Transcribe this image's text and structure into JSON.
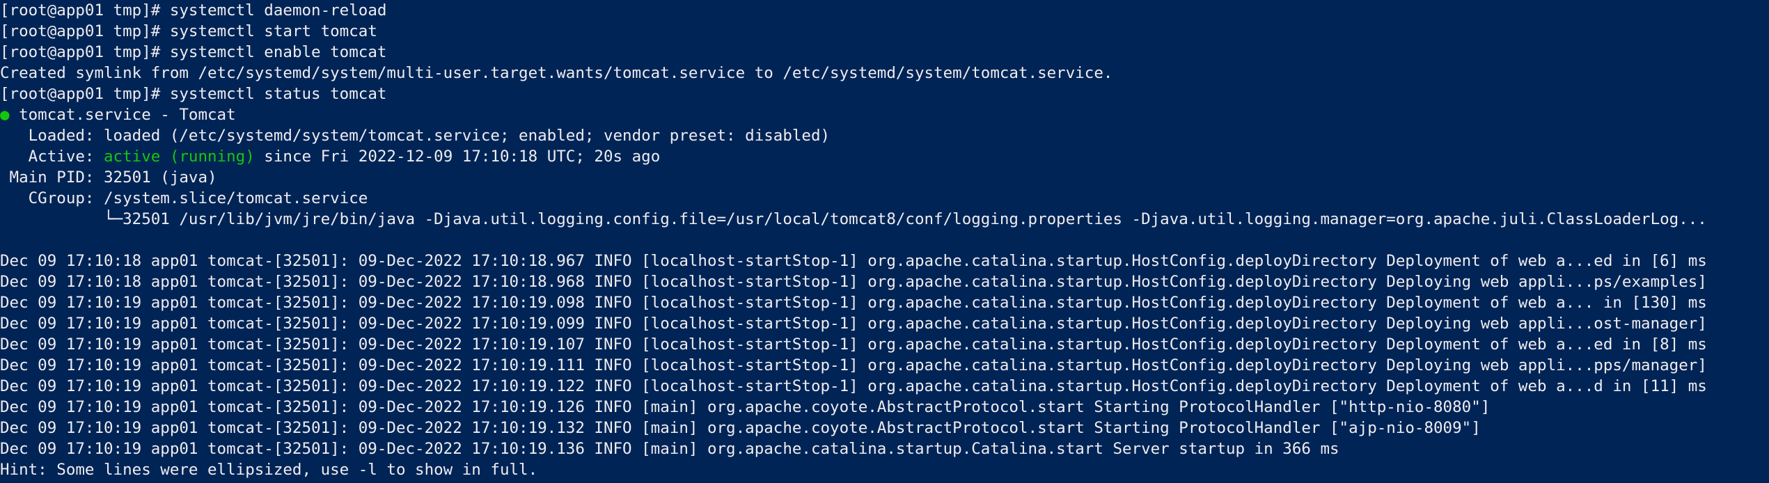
{
  "terminal": {
    "background": "#012456",
    "foreground": "#eeedf0",
    "accent_green": "#16c60c",
    "commands": [
      {
        "prompt": "[root@app01 tmp]# ",
        "cmd": "systemctl daemon-reload"
      },
      {
        "prompt": "[root@app01 tmp]# ",
        "cmd": "systemctl start tomcat"
      },
      {
        "prompt": "[root@app01 tmp]# ",
        "cmd": "systemctl enable tomcat"
      }
    ],
    "symlink_msg": "Created symlink from /etc/systemd/system/multi-user.target.wants/tomcat.service to /etc/systemd/system/tomcat.service.",
    "status_cmd": {
      "prompt": "[root@app01 tmp]# ",
      "cmd": "systemctl status tomcat"
    },
    "service": {
      "bullet": "●",
      "title": " tomcat.service - Tomcat",
      "loaded": "   Loaded: loaded (/etc/systemd/system/tomcat.service; enabled; vendor preset: disabled)",
      "active_label": "   Active: ",
      "active_state": "active (running)",
      "active_rest": " since Fri 2022-12-09 17:10:18 UTC; 20s ago",
      "main_pid": " Main PID: 32501 (java)",
      "cgroup": "   CGroup: /system.slice/tomcat.service",
      "process": "           └─32501 /usr/lib/jvm/jre/bin/java -Djava.util.logging.config.file=/usr/local/tomcat8/conf/logging.properties -Djava.util.logging.manager=org.apache.juli.ClassLoaderLog..."
    },
    "log_lines": [
      "Dec 09 17:10:18 app01 tomcat-[32501]: 09-Dec-2022 17:10:18.967 INFO [localhost-startStop-1] org.apache.catalina.startup.HostConfig.deployDirectory Deployment of web a...ed in [6] ms",
      "Dec 09 17:10:18 app01 tomcat-[32501]: 09-Dec-2022 17:10:18.968 INFO [localhost-startStop-1] org.apache.catalina.startup.HostConfig.deployDirectory Deploying web appli...ps/examples]",
      "Dec 09 17:10:19 app01 tomcat-[32501]: 09-Dec-2022 17:10:19.098 INFO [localhost-startStop-1] org.apache.catalina.startup.HostConfig.deployDirectory Deployment of web a... in [130] ms",
      "Dec 09 17:10:19 app01 tomcat-[32501]: 09-Dec-2022 17:10:19.099 INFO [localhost-startStop-1] org.apache.catalina.startup.HostConfig.deployDirectory Deploying web appli...ost-manager]",
      "Dec 09 17:10:19 app01 tomcat-[32501]: 09-Dec-2022 17:10:19.107 INFO [localhost-startStop-1] org.apache.catalina.startup.HostConfig.deployDirectory Deployment of web a...ed in [8] ms",
      "Dec 09 17:10:19 app01 tomcat-[32501]: 09-Dec-2022 17:10:19.111 INFO [localhost-startStop-1] org.apache.catalina.startup.HostConfig.deployDirectory Deploying web appli...pps/manager]",
      "Dec 09 17:10:19 app01 tomcat-[32501]: 09-Dec-2022 17:10:19.122 INFO [localhost-startStop-1] org.apache.catalina.startup.HostConfig.deployDirectory Deployment of web a...d in [11] ms",
      "Dec 09 17:10:19 app01 tomcat-[32501]: 09-Dec-2022 17:10:19.126 INFO [main] org.apache.coyote.AbstractProtocol.start Starting ProtocolHandler [\"http-nio-8080\"]",
      "Dec 09 17:10:19 app01 tomcat-[32501]: 09-Dec-2022 17:10:19.132 INFO [main] org.apache.coyote.AbstractProtocol.start Starting ProtocolHandler [\"ajp-nio-8009\"]",
      "Dec 09 17:10:19 app01 tomcat-[32501]: 09-Dec-2022 17:10:19.136 INFO [main] org.apache.catalina.startup.Catalina.start Server startup in 366 ms"
    ],
    "hint": "Hint: Some lines were ellipsized, use -l to show in full."
  }
}
